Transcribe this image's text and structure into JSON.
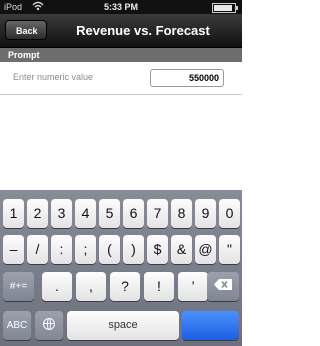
{
  "status_bar": {
    "carrier": "iPod",
    "time": "5:33 PM",
    "battery_level": 0.9
  },
  "nav": {
    "back_label": "Back",
    "title": "Revenue vs. Forecast"
  },
  "section": {
    "title": "Prompt"
  },
  "prompt": {
    "label": "Enter numeric value",
    "value": "550000"
  },
  "keyboard": {
    "row1": [
      "1",
      "2",
      "3",
      "4",
      "5",
      "6",
      "7",
      "8",
      "9",
      "0"
    ],
    "row2": [
      "–",
      "/",
      ":",
      ";",
      "(",
      ")",
      "$",
      "&",
      "@",
      "\""
    ],
    "row3_left": "#+=",
    "row3_mid": [
      ".",
      ",",
      "?",
      "!",
      "’"
    ],
    "row4_abc": "ABC",
    "row4_space": "space",
    "row4_return": "",
    "colors": {
      "return_key": "#2c6cf0"
    }
  }
}
